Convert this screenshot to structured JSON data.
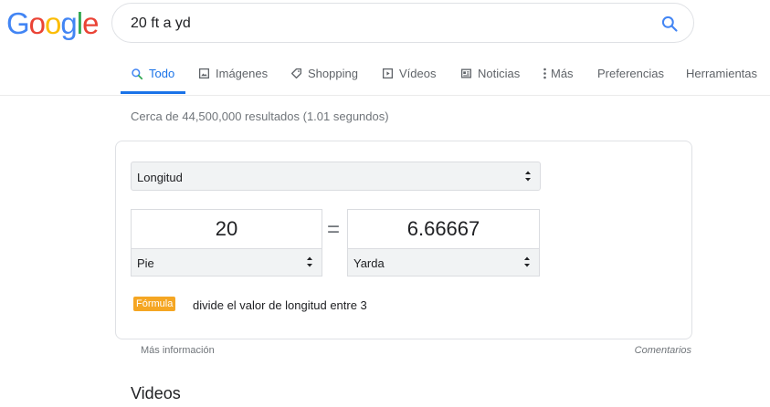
{
  "logo": {
    "letters": [
      "G",
      "o",
      "o",
      "g",
      "l",
      "e"
    ],
    "colors": [
      "#4285f4",
      "#ea4335",
      "#fbbc05",
      "#4285f4",
      "#34a853",
      "#ea4335"
    ]
  },
  "search": {
    "query": "20 ft a yd",
    "icon": "search-icon"
  },
  "tabs": [
    {
      "label": "Todo",
      "icon": "search-icon",
      "active": true
    },
    {
      "label": "Imágenes",
      "icon": "image-icon"
    },
    {
      "label": "Shopping",
      "icon": "tag-icon"
    },
    {
      "label": "Vídeos",
      "icon": "play-icon"
    },
    {
      "label": "Noticias",
      "icon": "news-icon"
    },
    {
      "label": "Más",
      "icon": "more-vert-icon"
    },
    {
      "label": "Preferencias"
    },
    {
      "label": "Herramientas"
    }
  ],
  "stats": "Cerca de 44,500,000 resultados (1.01 segundos)",
  "converter": {
    "category": "Longitud",
    "from": {
      "value": "20",
      "unit": "Pie"
    },
    "equals": "=",
    "to": {
      "value": "6.66667",
      "unit": "Yarda"
    },
    "formula_badge": "Fórmula",
    "formula_text": "divide el valor de longitud entre 3"
  },
  "footer": {
    "more_info": "Más información",
    "feedback": "Comentarios"
  },
  "videos_heading": "Videos",
  "colors": {
    "accent": "#1a73e8",
    "formula": "#f5a623"
  }
}
